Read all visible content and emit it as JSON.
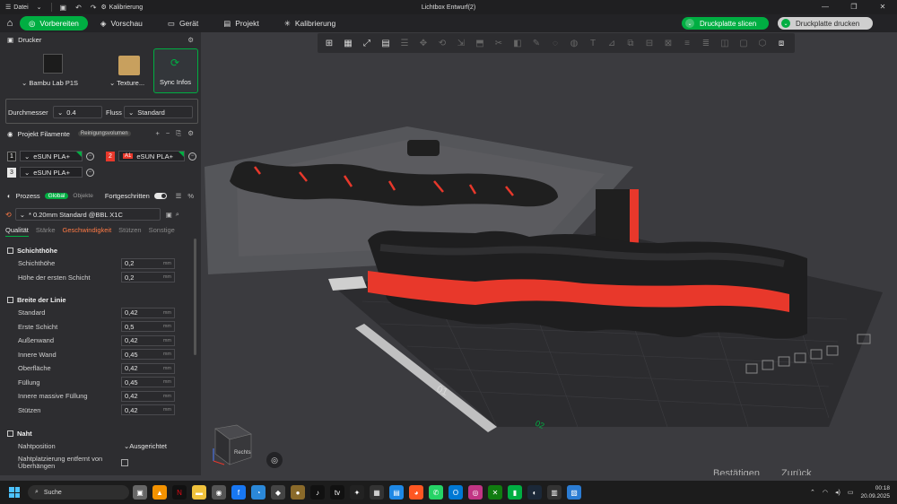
{
  "titlebar": {
    "menu_label": "Datei",
    "project_label": "Kalibrierung",
    "window_title": "Lichtbox Entwurf(2)"
  },
  "nav": {
    "tabs": [
      {
        "label": "Vorbereiten",
        "icon": "prepare-icon",
        "active": true
      },
      {
        "label": "Vorschau",
        "icon": "preview-icon"
      },
      {
        "label": "Gerät",
        "icon": "device-icon"
      },
      {
        "label": "Projekt",
        "icon": "project-icon"
      },
      {
        "label": "Kalibrierung",
        "icon": "calibration-icon"
      }
    ],
    "slice_label": "Druckplatte slicen",
    "print_label": "Druckplatte drucken"
  },
  "printer": {
    "section_title": "Drucker",
    "printer_name": "Bambu Lab P1S",
    "texture_label": "Texture...",
    "sync_label": "Sync Infos",
    "nozzle_label": "Durchmesser",
    "nozzle_value": "0.4",
    "flow_label": "Fluss",
    "flow_value": "Standard"
  },
  "filament": {
    "section_title": "Projekt Filamente",
    "purge_label": "Reinigungsvolumen",
    "items": [
      {
        "num": "1",
        "name": "eSUN PLA+",
        "num_color": "#1e1e1e"
      },
      {
        "num": "2",
        "name": "eSUN PLA+",
        "num_color": "#e8382b",
        "tag": "A1"
      },
      {
        "num": "3",
        "name": "eSUN PLA+",
        "num_color": "#e8e8e8"
      }
    ]
  },
  "process": {
    "section_title": "Prozess",
    "global_badge": "Global",
    "objects_label": "Objekte",
    "advanced_label": "Fortgeschritten",
    "preset": "* 0.20mm Standard @BBL X1C",
    "tabs": [
      "Qualität",
      "Stärke",
      "Geschwindigkeit",
      "Stützen",
      "Sonstige"
    ]
  },
  "params": {
    "layer_group": "Schichthöhe",
    "layer_rows": [
      {
        "label": "Schichthöhe",
        "value": "0,2",
        "unit": "mm"
      },
      {
        "label": "Höhe der ersten Schicht",
        "value": "0,2",
        "unit": "mm"
      }
    ],
    "width_group": "Breite der Linie",
    "width_rows": [
      {
        "label": "Standard",
        "value": "0,42",
        "unit": "mm"
      },
      {
        "label": "Erste Schicht",
        "value": "0,5",
        "unit": "mm"
      },
      {
        "label": "Außenwand",
        "value": "0,42",
        "unit": "mm"
      },
      {
        "label": "Innere Wand",
        "value": "0,45",
        "unit": "mm"
      },
      {
        "label": "Oberfläche",
        "value": "0,42",
        "unit": "mm"
      },
      {
        "label": "Füllung",
        "value": "0,45",
        "unit": "mm"
      },
      {
        "label": "Innere massive Füllung",
        "value": "0,42",
        "unit": "mm"
      },
      {
        "label": "Stützen",
        "value": "0,42",
        "unit": "mm"
      }
    ],
    "seam_group": "Naht",
    "seam_position_label": "Nahtposition",
    "seam_position_value": "Ausgerichtet",
    "seam_remove_label": "Nahtplatzierung entfernt von Überhängen"
  },
  "viewport": {
    "plate_label": "01",
    "plate_label_2": "02",
    "cube_label": "Rechts",
    "confirm_label": "Bestätigen",
    "back_label": "Zurück"
  },
  "taskbar": {
    "search_label": "Suche",
    "time": "00:18",
    "date": "20.09.2025"
  },
  "colors": {
    "accent": "#00ae42",
    "filament_red": "#e8382b",
    "model_dark": "#2a2a2a"
  }
}
